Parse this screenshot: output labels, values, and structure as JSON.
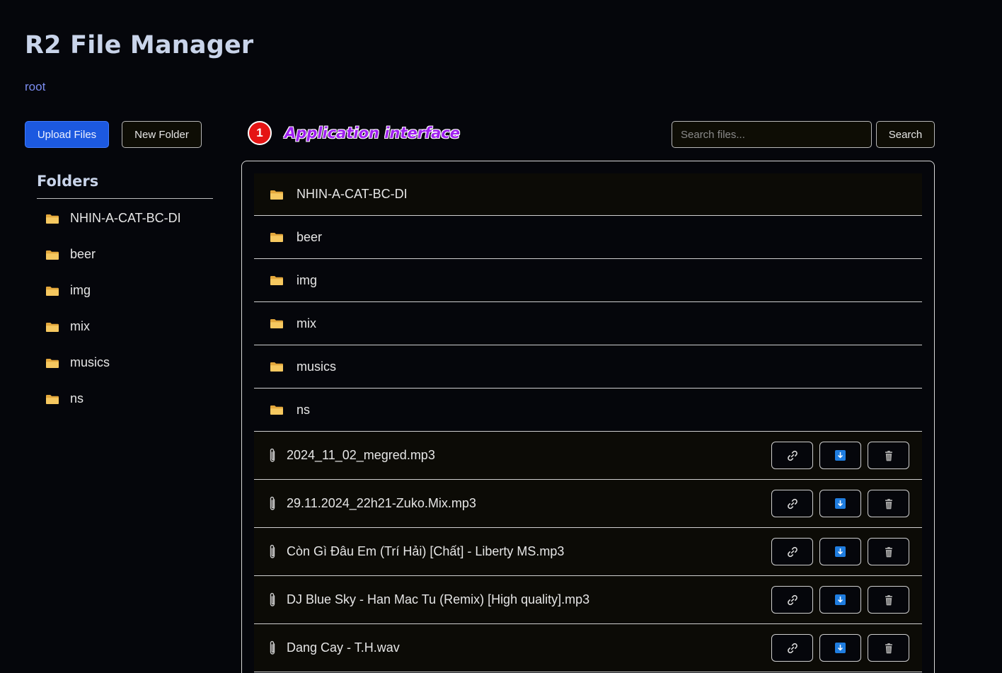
{
  "app": {
    "title": "R2 File Manager"
  },
  "breadcrumb": {
    "path": "root"
  },
  "toolbar": {
    "upload_label": "Upload Files",
    "new_folder_label": "New Folder",
    "search_placeholder": "Search files...",
    "search_label": "Search"
  },
  "annotation": {
    "number": "1",
    "text": "Application interface"
  },
  "sidebar": {
    "heading": "Folders",
    "items": [
      {
        "label": "NHIN-A-CAT-BC-DI"
      },
      {
        "label": "beer"
      },
      {
        "label": "img"
      },
      {
        "label": "mix"
      },
      {
        "label": "musics"
      },
      {
        "label": "ns"
      }
    ]
  },
  "main": {
    "folders": [
      {
        "label": "NHIN-A-CAT-BC-DI"
      },
      {
        "label": "beer"
      },
      {
        "label": "img"
      },
      {
        "label": "mix"
      },
      {
        "label": "musics"
      },
      {
        "label": "ns"
      }
    ],
    "files": [
      {
        "name": "2024_11_02_megred.mp3"
      },
      {
        "name": "29.11.2024_22h21-Zuko.Mix.mp3"
      },
      {
        "name": "Còn Gì Đâu Em (Trí Hải) [Chất] - Liberty MS.mp3"
      },
      {
        "name": "DJ Blue Sky - Han Mac Tu (Remix) [High quality].mp3"
      },
      {
        "name": "Dang Cay - T.H.wav"
      }
    ]
  },
  "icons": {
    "folder": "folder-icon",
    "file": "paperclip-icon",
    "copy_link": "link-icon",
    "download": "download-icon",
    "delete": "trash-icon"
  },
  "colors": {
    "background": "#05060b",
    "accent": "#1c59e0",
    "folder": "#f6c860",
    "annotation_badge": "#e51414",
    "annotation_text": "#a020f0"
  }
}
